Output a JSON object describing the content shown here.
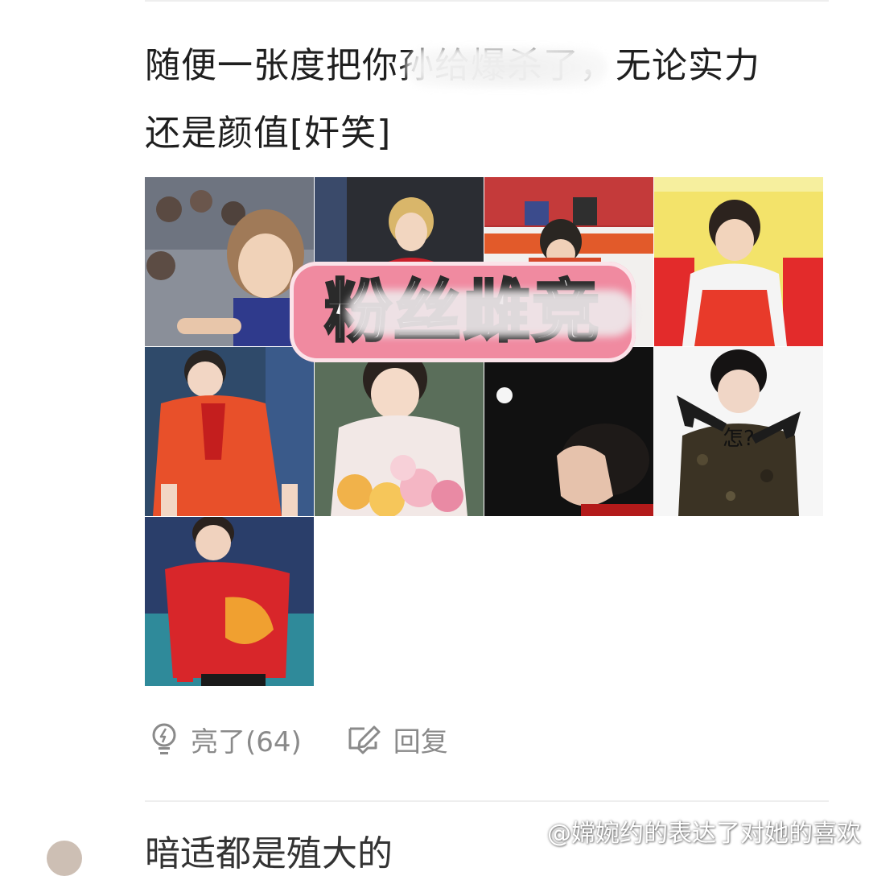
{
  "post": {
    "text_line1": "随便一张度把你孙给爆杀了，无论实力",
    "text_line2": "还是颜值[奸笑]"
  },
  "images": {
    "banner_text": "粉丝雌竞",
    "meme_caption": "怎?",
    "tiles": [
      {
        "name": "photo-player-ponytail-crowd"
      },
      {
        "name": "photo-player-blonde-red-jersey"
      },
      {
        "name": "photo-player-at-table-stadium"
      },
      {
        "name": "photo-player-tracksuit-team"
      },
      {
        "name": "photo-player-red-orange-shirt"
      },
      {
        "name": "photo-player-with-flowers"
      },
      {
        "name": "photo-player-dark-ball"
      },
      {
        "name": "photo-player-meme-guns"
      },
      {
        "name": "photo-player-red-china-shirt"
      }
    ]
  },
  "actions": {
    "like_label": "亮了(64)",
    "reply_label": "回复"
  },
  "next_comment": {
    "text_partial": "暗适都是殖大的"
  },
  "watermark": {
    "text": "@嫦婉约的表达了对她的喜欢"
  },
  "colors": {
    "text": "#1f1f1f",
    "action_gray": "#8a8a8a",
    "banner_pink": "#f08aa0",
    "divider": "#eeeeee"
  }
}
